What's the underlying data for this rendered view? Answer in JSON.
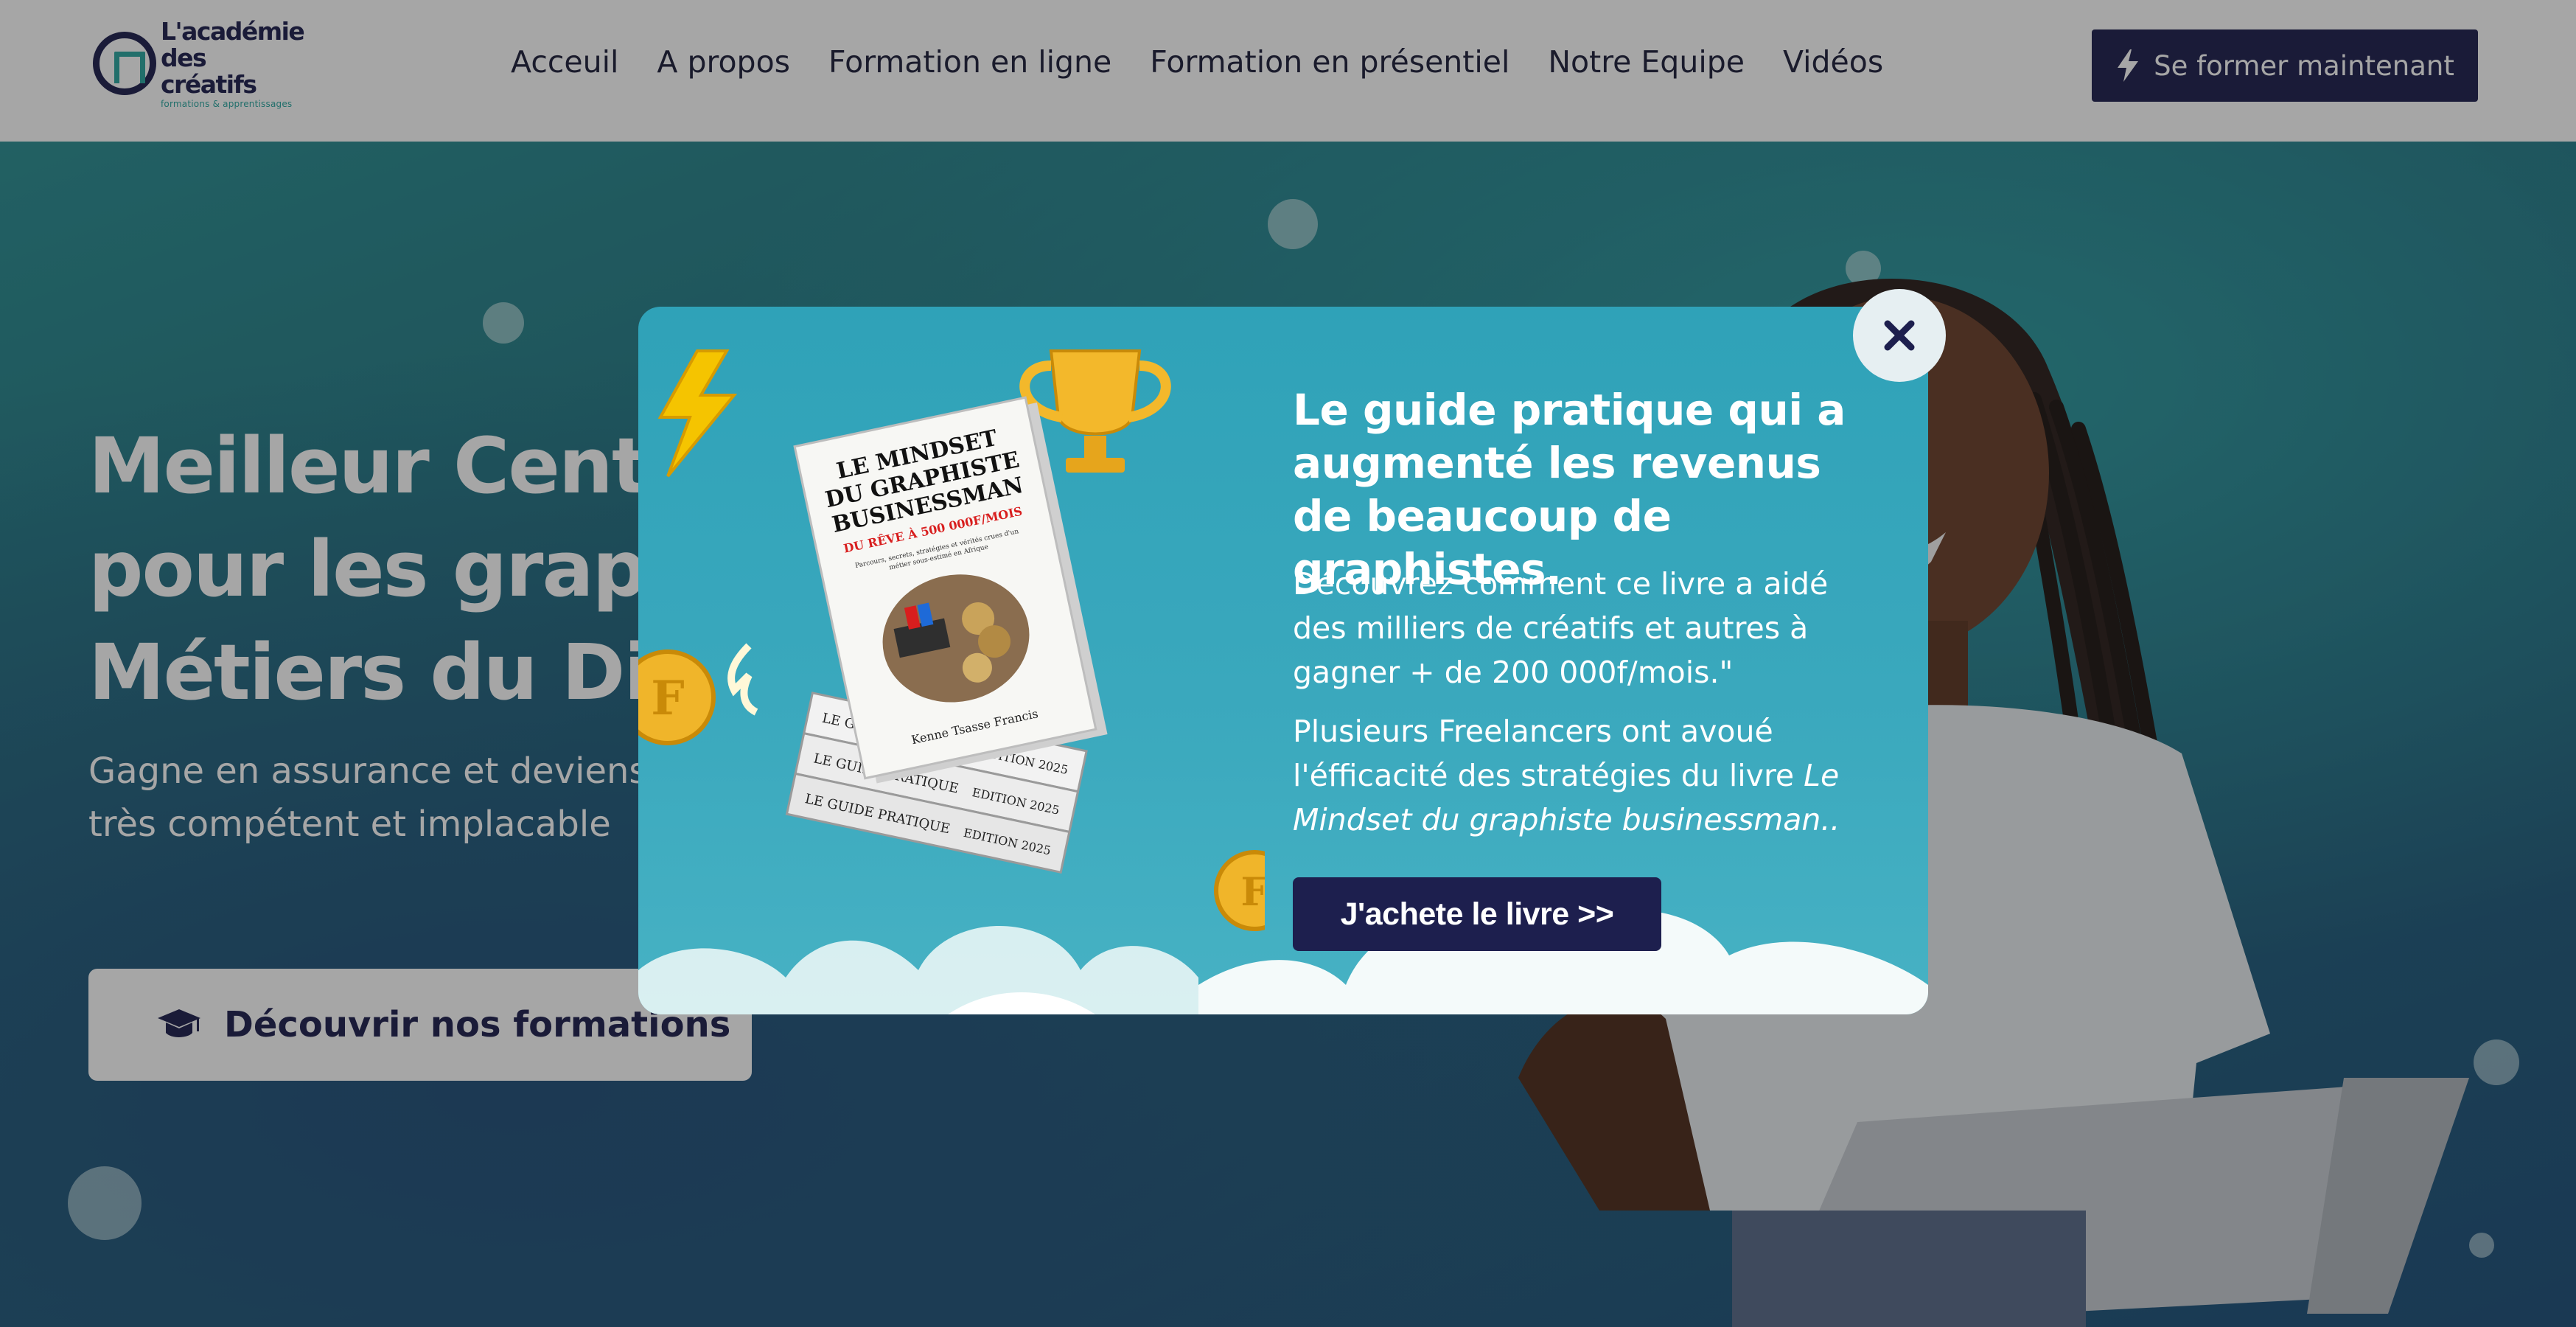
{
  "header": {
    "logo": {
      "line1": "L'académie",
      "line2": "des créatifs",
      "tagline": "formations & apprentissages"
    },
    "nav": [
      {
        "label": "Acceuil"
      },
      {
        "label": "A propos"
      },
      {
        "label": "Formation en ligne"
      },
      {
        "label": "Formation en présentiel"
      },
      {
        "label": "Notre Equipe"
      },
      {
        "label": "Vidéos"
      }
    ],
    "cta_label": "Se former maintenant",
    "cta_icon": "bolt-icon"
  },
  "hero": {
    "title_visible": "Meilleur Centr\npour les graph\nMétiers du Dig",
    "subtitle_visible": "Gagne en assurance et deviens\ntrès compétent et implacable",
    "cta_label": "Découvrir nos formations",
    "cta_icon": "graduation-cap-icon"
  },
  "modal": {
    "title": "Le guide pratique qui a augmenté les revenus de beaucoup de graphistes.",
    "paragraph1": "Découvrez comment ce livre a aidé des milliers de créatifs et autres à gagner + de 200 000f/mois.\"",
    "paragraph2_prefix": "Plusieurs Freelancers ont avoué l'éfficacité des stratégies du livre ",
    "paragraph2_italic": "Le Mindset du graphiste businessman..",
    "cta_label": "J'achete le livre >>",
    "close_icon": "close-icon",
    "book": {
      "title_line1": "LE MINDSET",
      "title_line2": "DU GRAPHISTE",
      "title_line3": "BUSINESSMAN",
      "subtitle": "DU RÊVE À 500 000F/MOIS",
      "tagline_line1": "Parcours, secrets, stratégies et vérités crues d'un",
      "tagline_line2": "métier sous-estimé en Afrique",
      "author": "Kenne Tsasse Francis",
      "spine_label": "LE GUIDE PRATIQUE",
      "edition_label": "EDITION 2025",
      "coin_letter": "F"
    }
  },
  "colors": {
    "brand_navy": "#1d1f4e",
    "brand_teal": "#2aa6a0",
    "modal_bg": "#33a5ba",
    "overlay": "rgba(20,20,20,0.38)"
  }
}
